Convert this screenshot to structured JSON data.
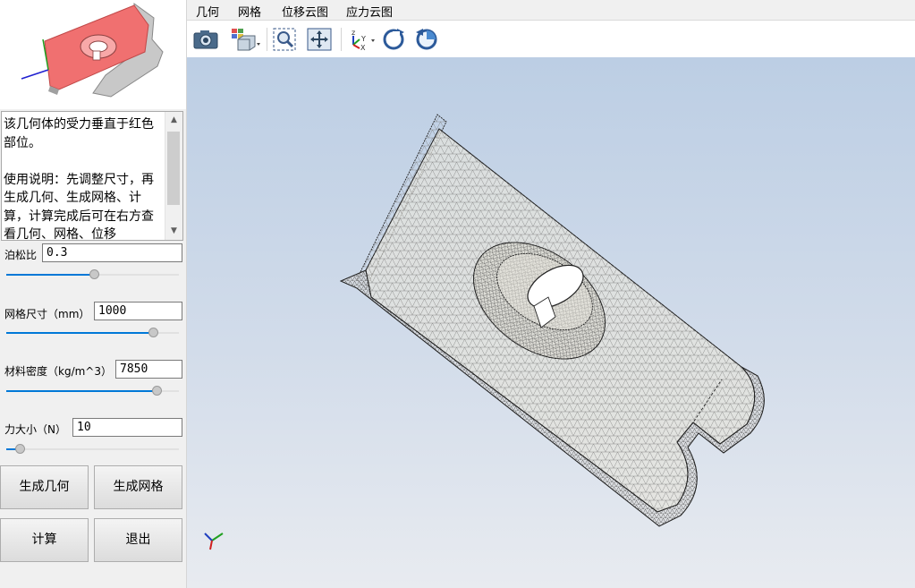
{
  "menu": [
    "几何",
    "网格",
    "位移云图",
    "应力云图"
  ],
  "toolbar": {
    "icons": [
      "camera-icon",
      "view-cube-icon",
      "zoom-window-icon",
      "fit-all-icon",
      "axes-triad-icon",
      "rotate-cw-icon",
      "rotate-ccw-icon"
    ]
  },
  "description": "该几何体的受力垂直于红色部位。\n\n使用说明：先调整尺寸，再生成几何、生成网格、计算，计算完成后可在右方查看几何、网格、位移",
  "params": [
    {
      "label": "泊松比",
      "value": "0.3",
      "slider": 0.51
    },
    {
      "label": "网格尺寸（mm）",
      "value": "1000",
      "slider": 0.85
    },
    {
      "label": "材料密度（kg/m^3）",
      "value": "7850",
      "slider": 0.87
    },
    {
      "label": "力大小（N）",
      "value": "10",
      "slider": 0.08
    }
  ],
  "buttons": {
    "gen_geometry": "生成几何",
    "gen_mesh": "生成网格",
    "compute": "计算",
    "exit": "退出"
  },
  "colors": {
    "highlight_face": "#f07070",
    "accent": "#0078d7"
  }
}
